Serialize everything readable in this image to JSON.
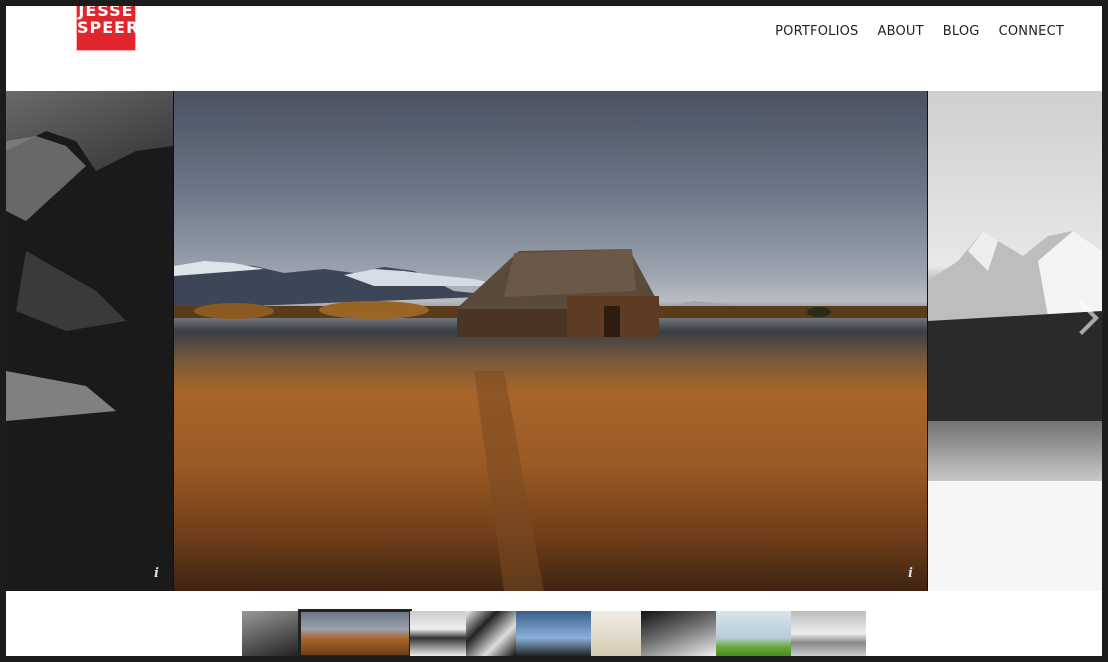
{
  "logo": {
    "line1": "JESSE",
    "line2": "SPEER"
  },
  "nav": {
    "items": [
      {
        "label": "PORTFOLIOS"
      },
      {
        "label": "ABOUT"
      },
      {
        "label": "BLOG"
      },
      {
        "label": "CONNECT"
      }
    ]
  },
  "slider": {
    "info_glyph": "i"
  },
  "thumbnails": {
    "count": 10,
    "active_index": 1
  },
  "colors": {
    "logo_red": "#e0262c",
    "nav_text": "#222222"
  }
}
